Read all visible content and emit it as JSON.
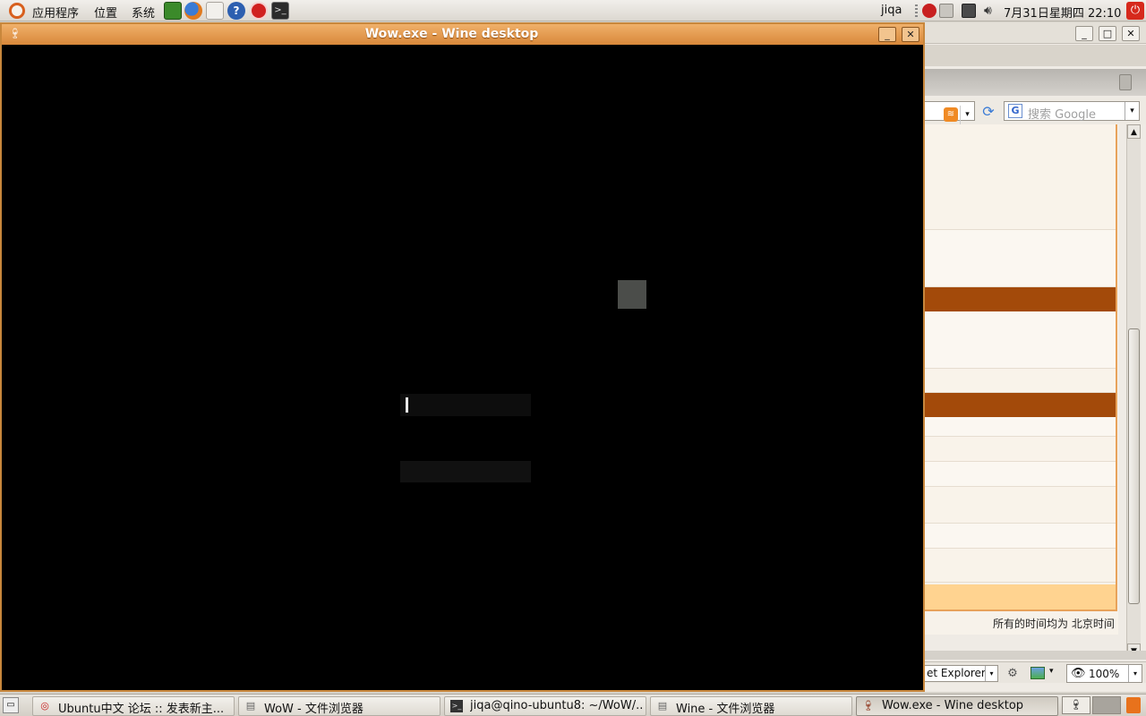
{
  "top_panel": {
    "menu_applications": "应用程序",
    "menu_places": "位置",
    "menu_system": "系统",
    "launchers": [
      "system-monitor-icon",
      "firefox-icon",
      "mail-icon",
      "help-icon",
      "opera-icon",
      "terminal-icon"
    ],
    "username": "jiqa",
    "clock": "7月31日星期四  22:10",
    "accent_color": "#d85f1d"
  },
  "wine_window": {
    "title": "Wow.exe - Wine desktop",
    "minimize_label": "_",
    "close_label": "✕",
    "titlebar_color": "#e09a4e",
    "client_color": "#000000"
  },
  "background_browser": {
    "search_placeholder": "搜索 Google",
    "timezone_note": "所有的时间均为 北京时间",
    "browser_select": "et Explorer",
    "zoom": "100%",
    "brown_row_color": "#a34a0a",
    "peach_row_color": "#ffd390"
  },
  "taskbar": {
    "tasks": [
      {
        "label": "Ubuntu中文 论坛 :: 发表新主...",
        "icon": "opera-icon"
      },
      {
        "label": "WoW - 文件浏览器",
        "icon": "file-browser-icon"
      },
      {
        "label": "jiqa@qino-ubuntu8: ~/WoW/...",
        "icon": "terminal-icon"
      },
      {
        "label": "Wine - 文件浏览器",
        "icon": "file-browser-icon"
      },
      {
        "label": "Wow.exe - Wine desktop",
        "icon": "wine-icon"
      }
    ]
  }
}
